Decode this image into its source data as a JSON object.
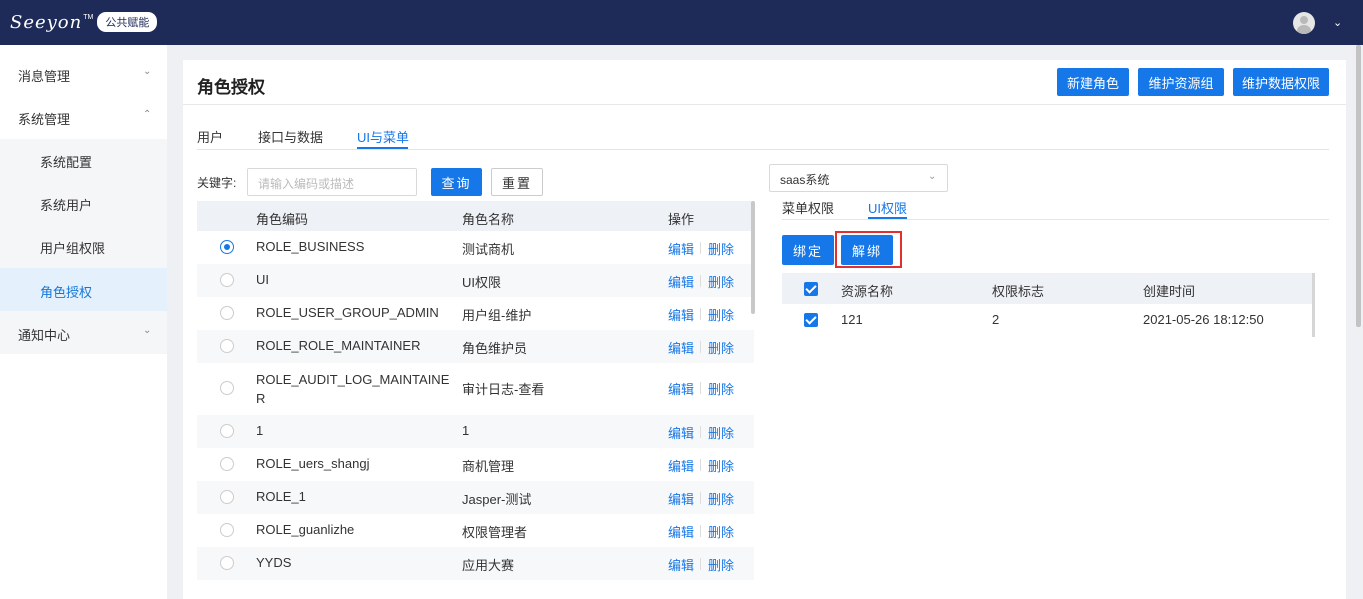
{
  "header": {
    "logo_text": "Seeyon",
    "logo_tm": "TM",
    "badge": "公共赋能",
    "user_menu_icon": "chevron-down-icon"
  },
  "sidebar": {
    "items": [
      {
        "label": "消息管理",
        "expanded": false
      },
      {
        "label": "系统管理",
        "expanded": true
      },
      {
        "label": "系统配置"
      },
      {
        "label": "系统用户"
      },
      {
        "label": "用户组权限"
      },
      {
        "label": "角色授权",
        "active": true
      },
      {
        "label": "通知中心",
        "expanded": false
      }
    ]
  },
  "main": {
    "title": "角色授权",
    "buttons": {
      "new_role": "新建角色",
      "maintain_resource_group": "维护资源组",
      "maintain_data_permission": "维护数据权限"
    },
    "tabs": [
      {
        "label": "用户"
      },
      {
        "label": "接口与数据"
      },
      {
        "label": "UI与菜单",
        "active": true
      }
    ],
    "search": {
      "label": "关键字:",
      "placeholder": "请输入编码或描述",
      "query_label": "查询",
      "reset_label": "重置"
    },
    "role_table": {
      "columns": [
        "角色编码",
        "角色名称",
        "操作"
      ],
      "edit_label": "编辑",
      "delete_label": "删除",
      "rows": [
        {
          "code": "ROLE_BUSINESS",
          "name": "测试商机",
          "selected": true
        },
        {
          "code": "UI",
          "name": "UI权限"
        },
        {
          "code": "ROLE_USER_GROUP_ADMIN",
          "name": "用户组-维护"
        },
        {
          "code": "ROLE_ROLE_MAINTAINER",
          "name": "角色维护员"
        },
        {
          "code": "ROLE_AUDIT_LOG_MAINTAINER",
          "name": "审计日志-查看"
        },
        {
          "code": "1",
          "name": "1"
        },
        {
          "code": "ROLE_uers_shangj",
          "name": "商机管理"
        },
        {
          "code": "ROLE_1",
          "name": "Jasper-测试"
        },
        {
          "code": "ROLE_guanlizhe",
          "name": "权限管理者"
        },
        {
          "code": "YYDS",
          "name": "应用大赛"
        }
      ]
    }
  },
  "right": {
    "system_select": "saas系统",
    "tabs": [
      {
        "label": "菜单权限"
      },
      {
        "label": "UI权限",
        "active": true
      }
    ],
    "bind_label": "绑定",
    "unbind_label": "解绑",
    "resource_table": {
      "columns": [
        "资源名称",
        "权限标志",
        "创建时间"
      ],
      "rows": [
        {
          "name": "121",
          "flag": "2",
          "created": "2021-05-26 18:12:50",
          "checked": true
        }
      ]
    }
  },
  "colors": {
    "topbar": "#1e2a58",
    "accent": "#1677e8",
    "highlight": "#e03030"
  }
}
